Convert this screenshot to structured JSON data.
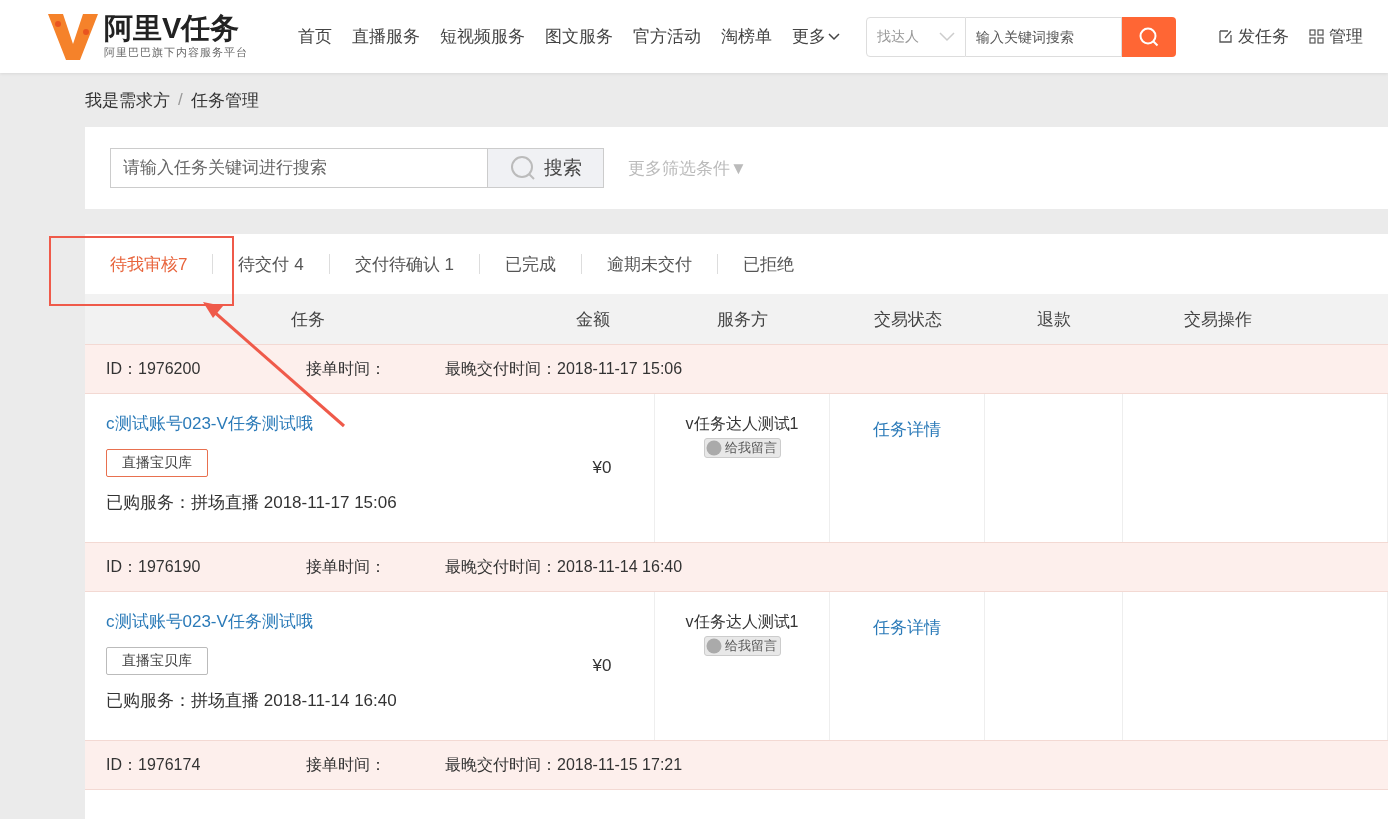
{
  "header": {
    "logo": {
      "title": "阿里V任务",
      "subtitle": "阿里巴巴旗下内容服务平台"
    },
    "nav": [
      {
        "label": "首页",
        "kind": "link"
      },
      {
        "label": "直播服务",
        "kind": "link"
      },
      {
        "label": "短视频服务",
        "kind": "link"
      },
      {
        "label": "图文服务",
        "kind": "link"
      },
      {
        "label": "官方活动",
        "kind": "link"
      },
      {
        "label": "淘榜单",
        "kind": "link"
      },
      {
        "label": "更多",
        "kind": "dropdown"
      }
    ],
    "search": {
      "scope": "找达人",
      "placeholder": "输入关键词搜索"
    },
    "actions": [
      {
        "label": "发任务",
        "kind": "edit"
      },
      {
        "label": "管理",
        "kind": "grid"
      }
    ]
  },
  "breadcrumb": {
    "items": [
      "我是需求方",
      "任务管理"
    ],
    "separator": "/"
  },
  "filter": {
    "placeholder": "请输入任务关键词进行搜索",
    "button": "搜索",
    "more": "更多筛选条件▼"
  },
  "tabs": [
    {
      "label": "待我审核7",
      "selected": true
    },
    {
      "label": "待交付 4",
      "selected": false
    },
    {
      "label": "交付待确认 1",
      "selected": false
    },
    {
      "label": "已完成",
      "selected": false
    },
    {
      "label": "逾期未交付",
      "selected": false
    },
    {
      "label": "已拒绝",
      "selected": false
    }
  ],
  "table": {
    "columns": [
      "任务",
      "金额",
      "服务方",
      "交易状态",
      "退款",
      "交易操作"
    ],
    "rows": [
      {
        "id": "ID：1976200",
        "accept_time": "接单时间：",
        "deadline": "最晚交付时间：2018-11-17 15:06",
        "task": "c测试账号023-V任务测试哦",
        "tag": {
          "label": "直播宝贝库",
          "active": true
        },
        "purchased": "已购服务：拼场直播 2018-11-17 15:06",
        "amount": "¥0",
        "provider": "v任务达人测试1",
        "message": "给我留言",
        "status_link": "任务详情"
      },
      {
        "id": "ID：1976190",
        "accept_time": "接单时间：",
        "deadline": "最晚交付时间：2018-11-14 16:40",
        "task": "c测试账号023-V任务测试哦",
        "tag": {
          "label": "直播宝贝库",
          "active": false
        },
        "purchased": "已购服务：拼场直播 2018-11-14 16:40",
        "amount": "¥0",
        "provider": "v任务达人测试1",
        "message": "给我留言",
        "status_link": "任务详情"
      },
      {
        "id": "ID：1976174",
        "accept_time": "接单时间：",
        "deadline": "最晚交付时间：2018-11-15 17:21"
      }
    ]
  }
}
